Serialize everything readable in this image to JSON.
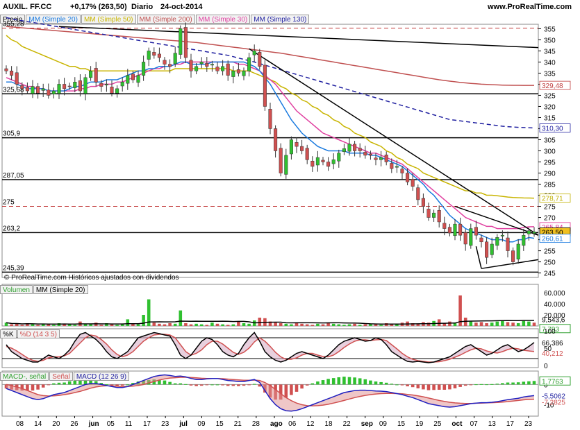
{
  "header": {
    "symbol": "AUXIL. FF.CC",
    "change": "+0,17% (263,50)",
    "period": "Diario",
    "date": "24-oct-2014",
    "site": "www.ProRealTime.com"
  },
  "price_panel": {
    "legend": [
      "Precio",
      "MM (Simple 20)",
      "MM (Simple 50)",
      "MM (Simple 200)",
      "MM (Simple 30)",
      "MM (Simple 130)"
    ],
    "level_labels": [
      "355,28",
      "325,68",
      "305,9",
      "287,05",
      "275",
      "263,2",
      "245,39"
    ],
    "value_labels": [
      {
        "text": "329,48",
        "value": 329.48,
        "color": "#c04040"
      },
      {
        "text": "310,30",
        "value": 310.3,
        "color": "#2020a0"
      },
      {
        "text": "278,71",
        "value": 278.71,
        "color": "#c0b000"
      },
      {
        "text": "265,84",
        "value": 265.84,
        "color": "#e03090"
      },
      {
        "text": "263,50",
        "value": 263.5,
        "color": "#000000",
        "bg": "#f0c020"
      },
      {
        "text": "260,61",
        "value": 260.61,
        "color": "#1a7adf"
      }
    ]
  },
  "volume_panel": {
    "legend": [
      "Volumen",
      "MM (Simple 20)"
    ],
    "value_labels": [
      "9,543,6",
      "7,793"
    ],
    "ticks": [
      "60.000",
      "40.000",
      "20.000"
    ]
  },
  "stoch_panel": {
    "legend": [
      "%K",
      "%D (14 3 5)"
    ],
    "value_labels": [
      "66,386",
      "40,212"
    ],
    "ticks": [
      "100",
      "50",
      "0"
    ]
  },
  "macd_panel": {
    "legend": [
      "MACD-, señal",
      "Señal",
      "MACD (12 26 9)"
    ],
    "value_labels": [
      "1,7763",
      "-5,5062",
      "-7,2825"
    ],
    "ticks": [
      "0",
      "-10"
    ]
  },
  "footer": "© ProRealTime.com  Históricos ajustados con dividendos",
  "x_axis": [
    "08",
    "14",
    "20",
    "26",
    "jun",
    "05",
    "11",
    "17",
    "23",
    "jul",
    "09",
    "15",
    "21",
    "28",
    "ago",
    "06",
    "12",
    "18",
    "22",
    "sep",
    "09",
    "15",
    "19",
    "25",
    "oct",
    "07",
    "13",
    "17",
    "23"
  ],
  "colors": {
    "up": "#30c030",
    "down": "#d05050",
    "sma20": "#1a7adf",
    "sma50": "#c8b400",
    "sma200": "#c05050",
    "sma30": "#e040a0",
    "sma130": "#2020a0"
  },
  "chart_data": {
    "type": "candlestick",
    "ylim": [
      243,
      357
    ],
    "y_ticks": [
      245,
      250,
      255,
      260,
      265,
      270,
      275,
      280,
      285,
      290,
      295,
      300,
      305,
      310,
      315,
      320,
      325,
      330,
      335,
      340,
      345,
      350,
      355
    ],
    "horizontal_levels": [
      355.28,
      325.68,
      305.9,
      287.05,
      275,
      263.2,
      245.39
    ],
    "closes": [
      336,
      334,
      330,
      328,
      327,
      329,
      326,
      328,
      325,
      327,
      330,
      328,
      329,
      331,
      327,
      333,
      336,
      331,
      329,
      330,
      326,
      328,
      331,
      334,
      332,
      334,
      340,
      345,
      343,
      342,
      339,
      338,
      344,
      355,
      342,
      336,
      338,
      340,
      338,
      339,
      336,
      338,
      334,
      336,
      335,
      336,
      342,
      345,
      338,
      320,
      310,
      300,
      290,
      298,
      305,
      302,
      300,
      296,
      293,
      297,
      295,
      293,
      296,
      299,
      301,
      303,
      300,
      300,
      298,
      298,
      296,
      297,
      295,
      292,
      293,
      290,
      286,
      284,
      278,
      275,
      270,
      272,
      268,
      265,
      263,
      267,
      262,
      258,
      265,
      262,
      259,
      252,
      258,
      261,
      262,
      255,
      250,
      258,
      262,
      264,
      263.5
    ],
    "sma20": [
      331,
      331,
      330,
      329,
      328,
      328,
      328,
      328,
      327,
      327,
      327,
      327,
      328,
      329,
      329,
      330,
      331,
      331,
      331,
      332,
      332,
      332,
      333,
      334,
      335,
      336,
      336,
      337,
      337,
      338,
      338,
      338,
      339,
      340,
      340,
      339,
      339,
      339,
      339,
      340,
      340,
      340,
      340,
      340,
      340,
      340,
      339,
      338,
      336,
      333,
      330,
      326,
      322,
      318,
      314,
      311,
      308,
      306,
      304,
      302,
      301,
      300,
      300,
      300,
      300,
      299,
      299,
      299,
      299,
      298,
      298,
      297,
      296,
      295,
      294,
      293,
      291,
      289,
      287,
      285,
      282,
      280,
      277,
      274,
      271,
      269,
      267,
      265,
      264,
      263,
      262,
      261,
      260,
      260,
      260,
      259,
      259,
      260,
      260,
      261,
      260.6
    ],
    "sma30": [
      333,
      332,
      331,
      330,
      329,
      329,
      328,
      328,
      327,
      327,
      327,
      327,
      327,
      327,
      328,
      328,
      329,
      329,
      330,
      330,
      330,
      331,
      331,
      332,
      333,
      334,
      335,
      336,
      337,
      337,
      338,
      338,
      339,
      339,
      340,
      340,
      340,
      340,
      340,
      340,
      340,
      340,
      340,
      340,
      339,
      339,
      338,
      337,
      336,
      334,
      332,
      330,
      327,
      324,
      321,
      318,
      316,
      314,
      312,
      310,
      308,
      307,
      306,
      305,
      304,
      303,
      302,
      301,
      300,
      299,
      299,
      298,
      297,
      296,
      295,
      294,
      292,
      290,
      288,
      286,
      284,
      282,
      280,
      278,
      276,
      274,
      272,
      270,
      269,
      268,
      267,
      266,
      266,
      265,
      265,
      265,
      265,
      265,
      265.5,
      265.8,
      265.84
    ],
    "sma50": [
      352,
      350,
      349,
      347,
      346,
      345,
      344,
      343,
      342,
      341,
      340,
      339,
      338,
      338,
      337,
      337,
      336,
      336,
      336,
      336,
      336,
      336,
      336,
      336,
      336,
      336,
      336,
      336,
      336,
      336,
      336,
      336,
      337,
      337,
      337,
      337,
      337,
      337,
      337,
      337,
      337,
      337,
      337,
      336,
      336,
      336,
      336,
      335,
      334,
      333,
      332,
      331,
      329,
      328,
      326,
      325,
      323,
      322,
      320,
      319,
      317,
      316,
      314,
      313,
      311,
      310,
      308,
      307,
      306,
      304,
      303,
      302,
      300,
      299,
      297,
      296,
      294,
      293,
      292,
      290,
      289,
      288,
      287,
      286,
      285,
      284,
      283,
      282,
      282,
      281,
      281,
      280,
      280,
      279.8,
      279.5,
      279.2,
      279,
      278.9,
      278.8,
      278.75,
      278.71
    ],
    "sma130": [
      360,
      359.5,
      359,
      358.6,
      358.2,
      357.8,
      357.4,
      357,
      356.6,
      356.2,
      355.8,
      355.4,
      355,
      354.6,
      354.2,
      353.8,
      353.4,
      353,
      352.6,
      352.2,
      351.8,
      351.4,
      351,
      350.6,
      350.2,
      349.8,
      349.4,
      349,
      348.6,
      348.2,
      347.8,
      347.4,
      347,
      346.6,
      346.2,
      345.8,
      345.4,
      345,
      344.6,
      344.2,
      343.8,
      343.4,
      343,
      342.4,
      341.8,
      341.2,
      340.6,
      340,
      339.3,
      338.6,
      337.9,
      337.2,
      336.5,
      335.8,
      335.1,
      334.4,
      333.7,
      333,
      332.3,
      331.6,
      330.9,
      330.2,
      329.5,
      328.8,
      328.1,
      327.4,
      326.7,
      326,
      325.3,
      324.6,
      323.9,
      323.2,
      322.5,
      321.8,
      321.1,
      320.4,
      319.7,
      319,
      318.3,
      317.6,
      316.9,
      316.2,
      315.5,
      314.8,
      314.1,
      313.8,
      313.5,
      313.2,
      312.9,
      312.6,
      312.3,
      312,
      311.7,
      311.4,
      311.1,
      310.9,
      310.7,
      310.6,
      310.5,
      310.4,
      310.3
    ],
    "sma200": [
      356,
      355.8,
      355.6,
      355.4,
      355.2,
      355,
      354.8,
      354.6,
      354.4,
      354.2,
      354,
      353.8,
      353.6,
      353.4,
      353.2,
      353,
      352.8,
      352.6,
      352.4,
      352.2,
      352,
      351.8,
      351.6,
      351.4,
      351.2,
      351,
      350.8,
      350.6,
      350.4,
      350.2,
      350,
      349.8,
      349.6,
      349.4,
      349.2,
      349,
      348.8,
      348.5,
      348.2,
      347.9,
      347.6,
      347.3,
      347,
      346.7,
      346.4,
      346.1,
      345.8,
      345.5,
      345.2,
      344.9,
      344.6,
      344.3,
      344,
      343.6,
      343.2,
      342.8,
      342.4,
      342,
      341.6,
      341.2,
      340.8,
      340.4,
      340,
      339.6,
      339.2,
      338.8,
      338.4,
      338,
      337.6,
      337.2,
      336.8,
      336.4,
      336,
      335.6,
      335.2,
      334.8,
      334.4,
      334,
      333.6,
      333.2,
      332.8,
      332.4,
      332,
      331.7,
      331.4,
      331.1,
      330.8,
      330.6,
      330.4,
      330.2,
      330,
      329.9,
      329.8,
      329.7,
      329.6,
      329.55,
      329.52,
      329.5,
      329.49,
      329.48,
      329.48
    ],
    "volume": [
      6,
      3,
      4,
      2,
      5,
      3,
      2,
      4,
      3,
      2,
      5,
      4,
      3,
      2,
      8,
      4,
      3,
      6,
      2,
      5,
      3,
      2,
      4,
      12,
      5,
      3,
      20,
      48,
      6,
      4,
      3,
      5,
      4,
      28,
      5,
      3,
      4,
      3,
      2,
      6,
      4,
      3,
      2,
      3,
      8,
      5,
      4,
      10,
      15,
      14,
      8,
      6,
      5,
      4,
      3,
      5,
      4,
      3,
      2,
      4,
      3,
      5,
      4,
      3,
      2,
      3,
      4,
      2,
      3,
      4,
      3,
      2,
      5,
      4,
      3,
      6,
      8,
      5,
      4,
      7,
      6,
      9,
      12,
      5,
      8,
      6,
      55,
      15,
      8,
      6,
      7,
      5,
      6,
      8,
      10,
      7,
      6,
      5,
      9,
      8,
      6
    ],
    "stoch_k": [
      60,
      40,
      30,
      20,
      15,
      10,
      10,
      20,
      30,
      25,
      20,
      30,
      45,
      70,
      90,
      95,
      85,
      75,
      60,
      40,
      25,
      20,
      30,
      40,
      60,
      80,
      85,
      90,
      95,
      92,
      88,
      85,
      60,
      30,
      20,
      30,
      50,
      70,
      80,
      75,
      60,
      40,
      30,
      25,
      35,
      60,
      80,
      95,
      70,
      40,
      25,
      15,
      10,
      15,
      25,
      35,
      40,
      35,
      30,
      25,
      20,
      30,
      45,
      60,
      70,
      75,
      80,
      75,
      70,
      72,
      80,
      75,
      60,
      40,
      30,
      20,
      12,
      10,
      12,
      10,
      8,
      10,
      15,
      20,
      25,
      35,
      45,
      55,
      60,
      50,
      40,
      30,
      35,
      45,
      55,
      60,
      50,
      40,
      45,
      55,
      66.386
    ],
    "stoch_d": [
      55,
      50,
      42,
      32,
      22,
      15,
      12,
      15,
      22,
      25,
      25,
      28,
      35,
      50,
      65,
      80,
      88,
      85,
      75,
      62,
      45,
      32,
      25,
      30,
      40,
      55,
      70,
      80,
      88,
      90,
      90,
      88,
      80,
      60,
      40,
      30,
      35,
      45,
      60,
      70,
      70,
      62,
      50,
      38,
      32,
      38,
      50,
      68,
      80,
      70,
      55,
      38,
      25,
      18,
      18,
      22,
      30,
      35,
      35,
      30,
      26,
      25,
      30,
      40,
      52,
      62,
      70,
      74,
      74,
      72,
      74,
      75,
      72,
      60,
      48,
      35,
      25,
      18,
      14,
      12,
      10,
      10,
      11,
      14,
      18,
      24,
      30,
      38,
      45,
      50,
      48,
      42,
      38,
      36,
      40,
      46,
      50,
      48,
      44,
      42,
      40.212
    ],
    "macd": [
      -2,
      -3,
      -4,
      -5,
      -6,
      -7,
      -7.5,
      -7,
      -6,
      -5,
      -4.5,
      -4,
      -3,
      -2,
      -1,
      0,
      0.5,
      0.5,
      0,
      -0.5,
      -1,
      -1.5,
      -1.5,
      -1,
      0,
      1,
      2,
      3,
      4,
      4.5,
      4.8,
      4.5,
      4,
      4.2,
      3.8,
      3,
      2.5,
      2.5,
      2.8,
      3,
      3,
      2.5,
      2,
      1.8,
      1.5,
      1.5,
      2,
      2.5,
      1,
      -3,
      -7,
      -10,
      -12,
      -13,
      -13.2,
      -12.8,
      -12,
      -11,
      -10,
      -9,
      -8,
      -7,
      -6,
      -5,
      -4,
      -3.5,
      -3,
      -2.8,
      -2.8,
      -3,
      -3.2,
      -3.3,
      -3.5,
      -4,
      -4.5,
      -5,
      -5.8,
      -6.5,
      -7.5,
      -8.5,
      -9.5,
      -10,
      -10.5,
      -11,
      -11.2,
      -11,
      -10.5,
      -10,
      -9.5,
      -9.2,
      -9,
      -9,
      -8.8,
      -8.5,
      -8,
      -7.5,
      -7.2,
      -6.8,
      -6.2,
      -5.8,
      -5.5062
    ],
    "macd_signal": [
      0,
      -0.5,
      -1.2,
      -2,
      -3,
      -4,
      -5,
      -5.5,
      -5.7,
      -5.6,
      -5.4,
      -5,
      -4.6,
      -4,
      -3.4,
      -2.6,
      -1.8,
      -1.2,
      -0.8,
      -0.6,
      -0.6,
      -0.8,
      -1,
      -1,
      -0.8,
      -0.5,
      0,
      0.8,
      1.5,
      2.2,
      2.8,
      3.2,
      3.4,
      3.6,
      3.6,
      3.5,
      3.3,
      3.1,
      3,
      3,
      3,
      2.9,
      2.7,
      2.5,
      2.3,
      2.1,
      2.1,
      2.2,
      2,
      1,
      -0.5,
      -2.5,
      -4.5,
      -6.5,
      -8,
      -9.2,
      -10,
      -10.5,
      -10.6,
      -10.5,
      -10.2,
      -9.8,
      -9.2,
      -8.6,
      -7.9,
      -7.2,
      -6.5,
      -5.9,
      -5.4,
      -5,
      -4.7,
      -4.5,
      -4.4,
      -4.4,
      -4.5,
      -4.6,
      -4.9,
      -5.2,
      -5.6,
      -6.1,
      -6.7,
      -7.3,
      -7.9,
      -8.4,
      -8.8,
      -9.1,
      -9.3,
      -9.4,
      -9.4,
      -9.3,
      -9.2,
      -9.1,
      -9,
      -8.9,
      -8.7,
      -8.5,
      -8.2,
      -7.9,
      -7.6,
      -7.4,
      -7.2825
    ]
  }
}
